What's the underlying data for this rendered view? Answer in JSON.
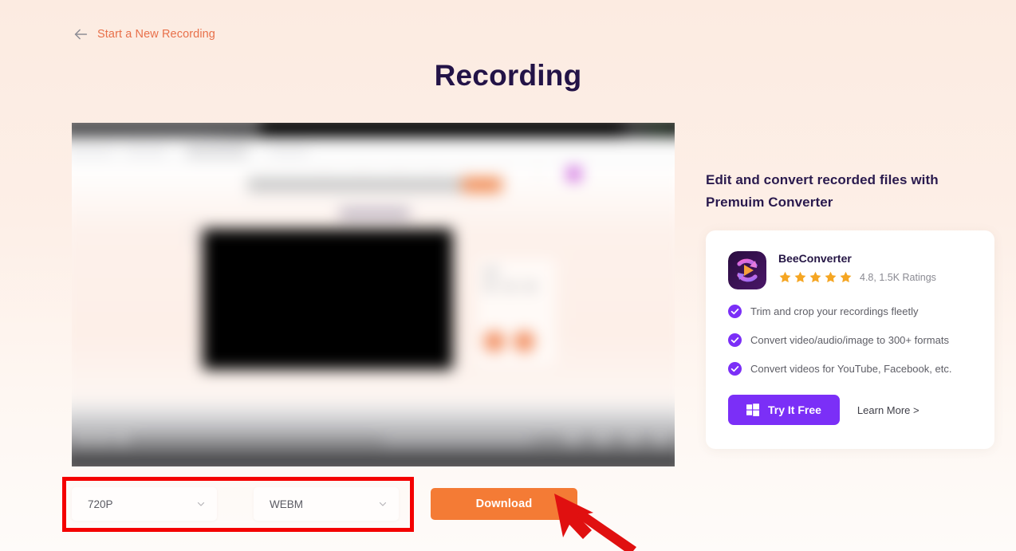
{
  "nav": {
    "back_icon": "arrow-left-icon",
    "back_label": "Start a New Recording"
  },
  "page_title": "Recording",
  "video_preview": {
    "alt": "blurred recorded screen preview"
  },
  "promo": {
    "heading": "Edit and convert recorded files with Premuim Converter",
    "app": {
      "icon": "beeconverter-app-icon",
      "name": "BeeConverter",
      "stars": 5,
      "rating_text": "4.8, 1.5K Ratings"
    },
    "features": [
      "Trim and crop your recordings fleetly",
      "Convert video/audio/image to 300+ formats",
      "Convert videos for YouTube, Facebook, etc."
    ],
    "cta": {
      "try_icon": "windows-icon",
      "try_label": "Try It Free",
      "learn_more_label": "Learn More >"
    }
  },
  "controls": {
    "resolution": {
      "value": "720P",
      "placeholder": "Resolution",
      "chevron": "chevron-down-icon",
      "options": [
        "720P"
      ]
    },
    "format": {
      "value": "WEBM",
      "placeholder": "Format",
      "chevron": "chevron-down-icon",
      "options": [
        "WEBM"
      ]
    },
    "download_label": "Download"
  },
  "annotations": {
    "highlight_box_color": "#f40000",
    "cursor_arrow_color": "#e01010"
  },
  "colors": {
    "background_top": "#fcebe1",
    "background_bottom": "#fefbf9",
    "accent_orange": "#f47b35",
    "link_orange": "#e8704a",
    "title_purple": "#231347",
    "brand_purple": "#7b2ff7",
    "star_gold": "#f5a623"
  }
}
